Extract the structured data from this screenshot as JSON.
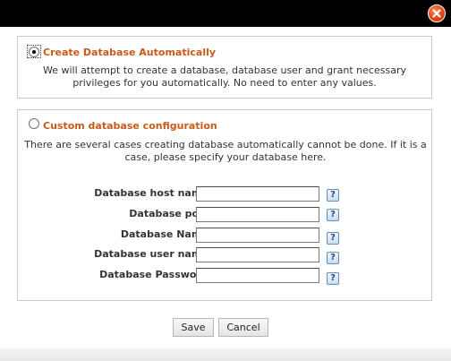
{
  "option_auto": {
    "label": "Create Database Automatically",
    "description": "We will attempt to create a database, database user and grant necessary privileges for you automatically. No need to enter any values.",
    "selected": true
  },
  "option_custom": {
    "label": "Custom database configuration",
    "description": "There are several cases creating database automatically cannot be done. If it is a case, please specify your database here.",
    "selected": false
  },
  "fields": [
    {
      "label": "Database host name :",
      "value": ""
    },
    {
      "label": "Database port :",
      "value": ""
    },
    {
      "label": "Database Name :",
      "value": ""
    },
    {
      "label": "Database user name :",
      "value": ""
    },
    {
      "label": "Database Password :",
      "value": ""
    }
  ],
  "help_icon": {
    "glyph": "?",
    "name": "help-icon"
  },
  "buttons": {
    "save": "Save",
    "cancel": "Cancel"
  },
  "close_icon": "close-icon",
  "colors": {
    "accent_label": "#c85a1a",
    "titlebar": "#000000",
    "close": "#e2460f"
  }
}
